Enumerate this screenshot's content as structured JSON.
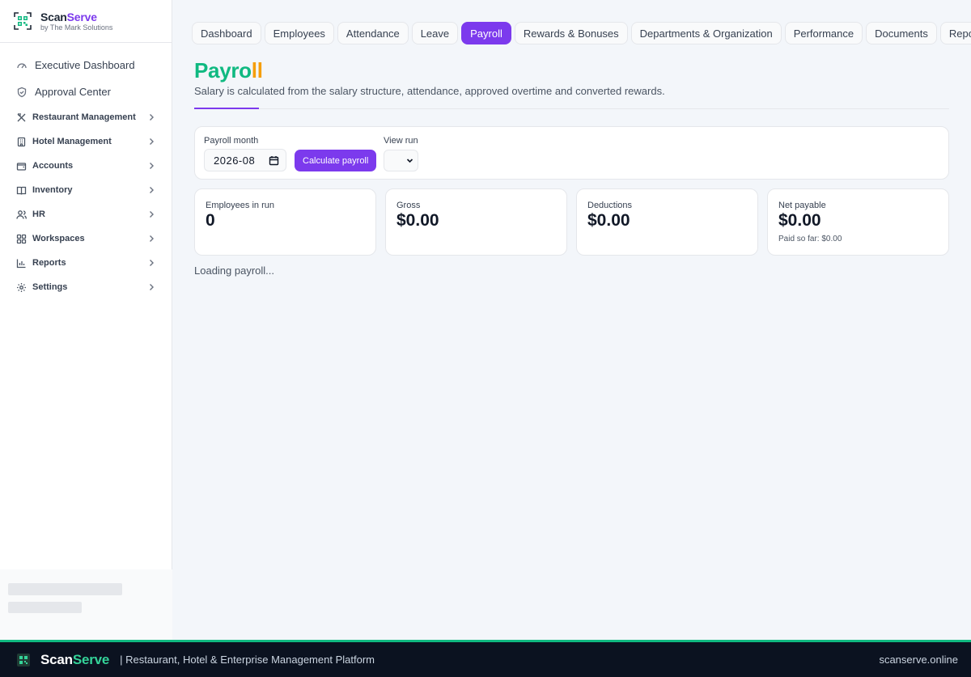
{
  "brand": {
    "name_part1": "Scan",
    "name_part2": "Serve",
    "subtitle": "by The Mark Solutions"
  },
  "sidebar": {
    "top_items": [
      {
        "label": "Executive Dashboard",
        "icon": "gauge-icon"
      },
      {
        "label": "Approval Center",
        "icon": "shield-check-icon"
      }
    ],
    "sections": [
      {
        "label": "Restaurant Management",
        "icon": "utensils-icon"
      },
      {
        "label": "Hotel Management",
        "icon": "building-icon"
      },
      {
        "label": "Accounts",
        "icon": "wallet-icon"
      },
      {
        "label": "Inventory",
        "icon": "book-icon"
      },
      {
        "label": "HR",
        "icon": "users-icon"
      },
      {
        "label": "Workspaces",
        "icon": "grid-icon"
      },
      {
        "label": "Reports",
        "icon": "bar-chart-icon"
      },
      {
        "label": "Settings",
        "icon": "gear-icon"
      }
    ]
  },
  "tabs": [
    "Dashboard",
    "Employees",
    "Attendance",
    "Leave",
    "Payroll",
    "Rewards & Bonuses",
    "Departments & Organization",
    "Performance",
    "Documents",
    "Reports"
  ],
  "active_tab": "Payroll",
  "page": {
    "title_part1": "Payro",
    "title_part2": "ll",
    "subtitle": "Salary is calculated from the salary structure, attendance, approved overtime and converted rewards."
  },
  "filters": {
    "month_label": "Payroll month",
    "month_value": "2026-08",
    "calculate_label": "Calculate payroll",
    "run_label": "View run",
    "run_value": ""
  },
  "stats": [
    {
      "label": "Employees in run",
      "value": "0",
      "note": ""
    },
    {
      "label": "Gross",
      "value": "$0.00",
      "note": ""
    },
    {
      "label": "Deductions",
      "value": "$0.00",
      "note": ""
    },
    {
      "label": "Net payable",
      "value": "$0.00",
      "note": "Paid so far: $0.00"
    }
  ],
  "loading_text": "Loading payroll...",
  "footer": {
    "brand_part1": "Scan",
    "brand_part2": "Serve",
    "tagline": "| Restaurant, Hotel & Enterprise Management Platform",
    "site": "scanserve.online"
  },
  "colors": {
    "accent": "#7c3aed",
    "title_green": "#10b981",
    "title_orange": "#f59e0b",
    "footer_bg": "#0b1220"
  }
}
